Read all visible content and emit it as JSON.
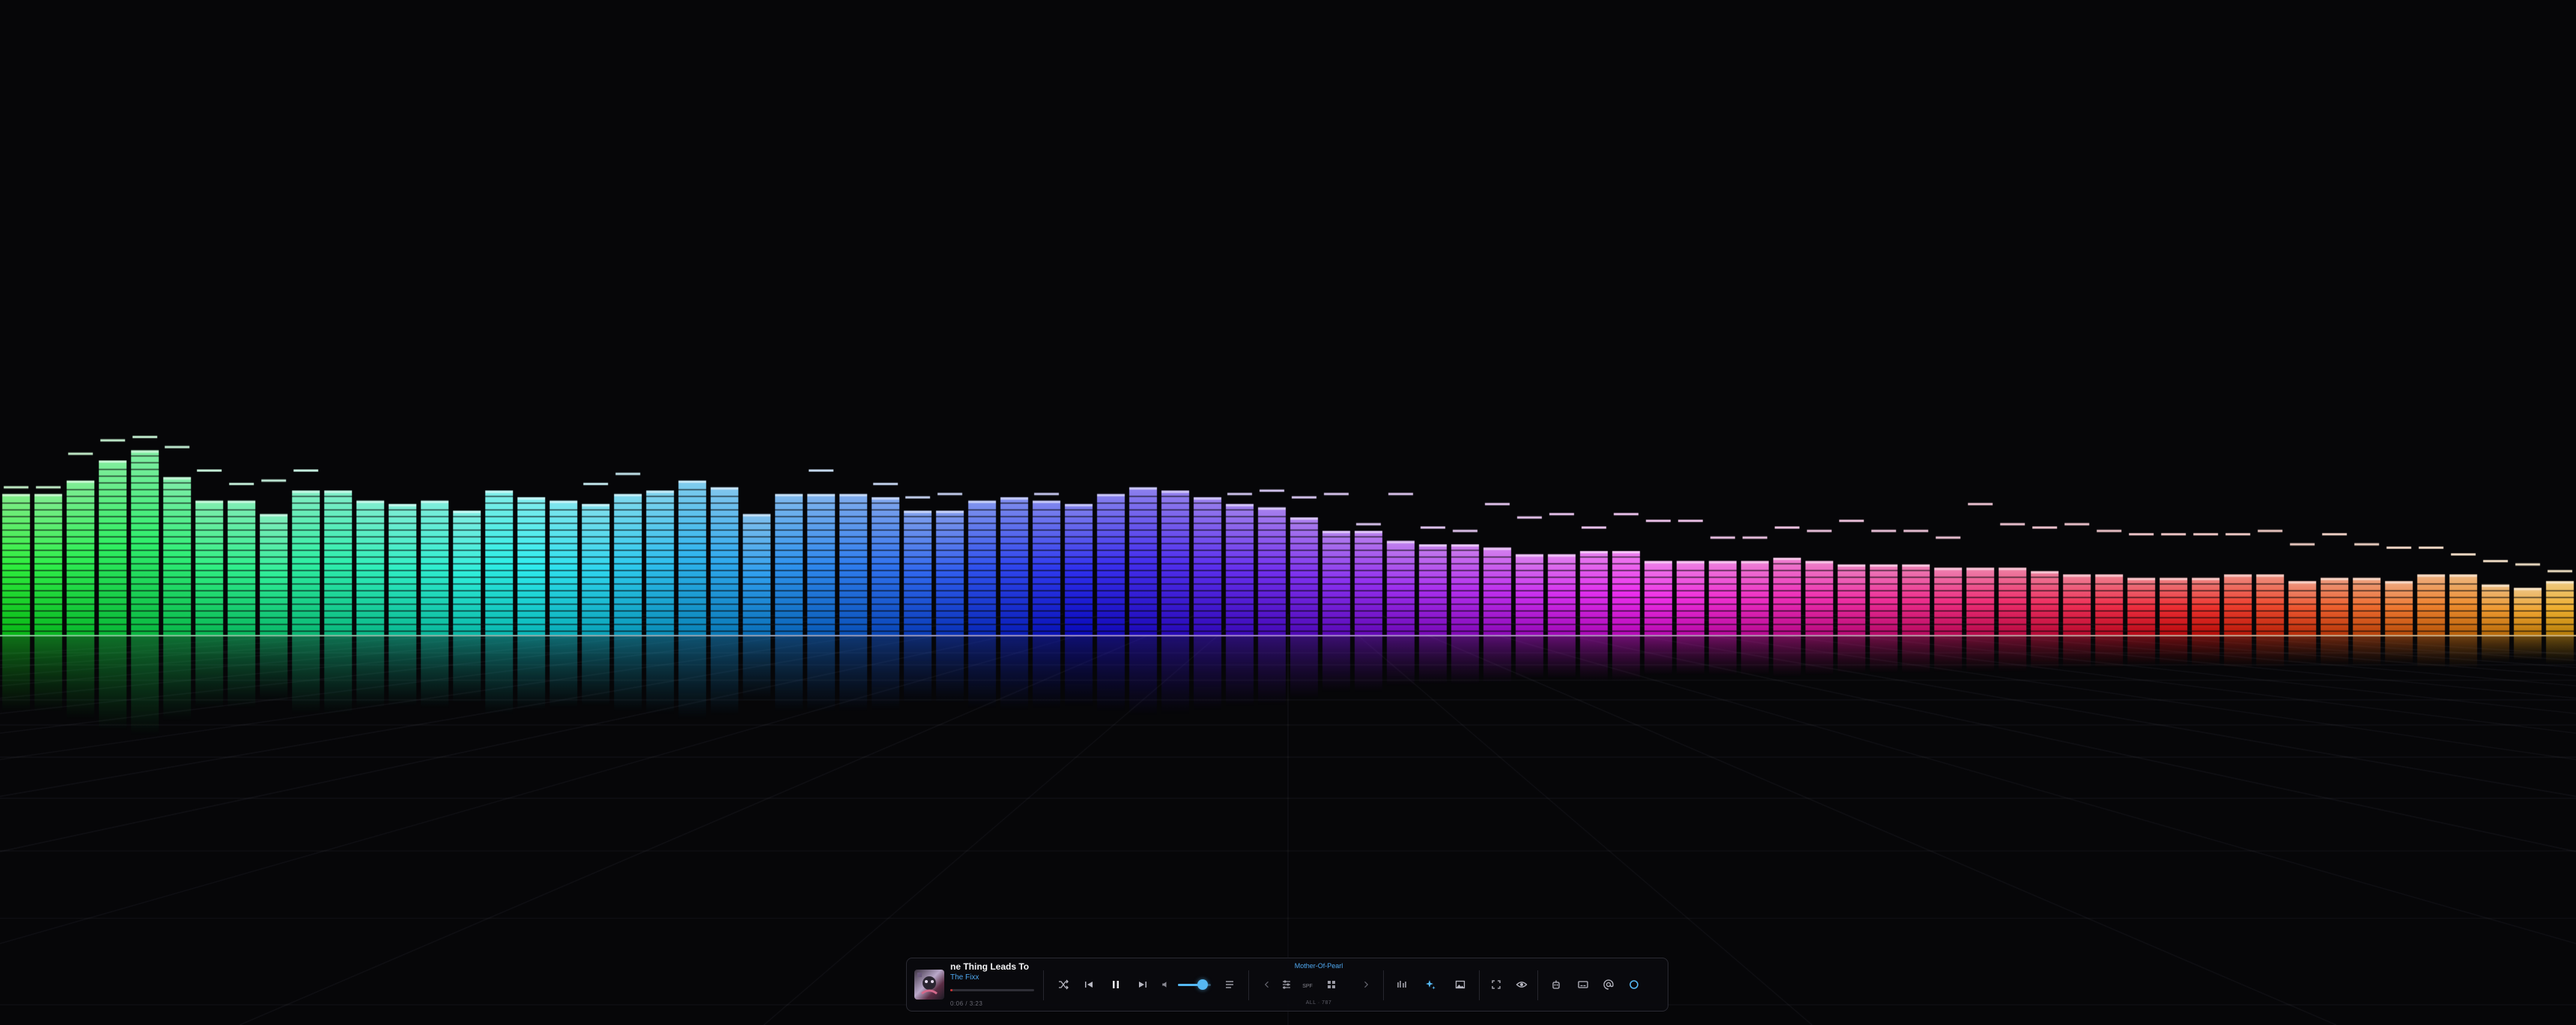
{
  "player": {
    "track_title": "ne Thing Leads To",
    "artist": "The Fixx",
    "time": "0:06 / 3:23",
    "progress": 0.03,
    "volume": 0.75,
    "preset_name": "Mother-Of-Pearl",
    "fps_badge": "SPF",
    "preset_meta": "ALL · 787"
  },
  "icons": {
    "album_art": "album-art",
    "shuffle": "shuffle-icon",
    "previous": "skip-previous-icon",
    "pause": "pause-icon",
    "next": "skip-next-icon",
    "volume": "volume-icon",
    "queue": "queue-list-icon",
    "prev_preset": "chevron-left-icon",
    "preset_settings": "sliders-icon",
    "grid": "grid-icon",
    "next_preset": "chevron-right-icon",
    "visualizer_mode": "bars-icon",
    "ai_sparkle": "sparkle-icon",
    "image": "image-icon",
    "fullscreen": "fullscreen-icon",
    "eye": "eye-icon",
    "robot": "robot-icon",
    "caption": "caption-icon",
    "at": "at-sign-icon",
    "circle": "circle-icon"
  },
  "colors": {
    "accent": "#4fa8f0",
    "background": "#060608",
    "progress": "#cc3333"
  },
  "visualizer": {
    "band_levels": [
      0.42,
      0.42,
      0.46,
      0.52,
      0.55,
      0.47,
      0.4,
      0.4,
      0.36,
      0.43,
      0.43,
      0.4,
      0.39,
      0.4,
      0.37,
      0.43,
      0.41,
      0.4,
      0.39,
      0.42,
      0.43,
      0.46,
      0.44,
      0.36,
      0.42,
      0.42,
      0.42,
      0.41,
      0.37,
      0.37,
      0.4,
      0.41,
      0.4,
      0.39,
      0.42,
      0.44,
      0.43,
      0.41,
      0.39,
      0.38,
      0.35,
      0.31,
      0.31,
      0.28,
      0.27,
      0.27,
      0.26,
      0.24,
      0.24,
      0.25,
      0.25,
      0.22,
      0.22,
      0.22,
      0.22,
      0.23,
      0.22,
      0.21,
      0.21,
      0.21,
      0.2,
      0.2,
      0.2,
      0.19,
      0.18,
      0.18,
      0.17,
      0.17,
      0.17,
      0.18,
      0.18,
      0.16,
      0.17,
      0.17,
      0.16,
      0.18,
      0.18,
      0.15,
      0.14,
      0.16
    ],
    "peak_levels": [
      0.43,
      0.43,
      0.53,
      0.57,
      0.58,
      0.55,
      0.48,
      0.44,
      0.45,
      0.48,
      0.43,
      0.4,
      0.39,
      0.4,
      0.37,
      0.43,
      0.41,
      0.4,
      0.44,
      0.47,
      0.43,
      0.46,
      0.44,
      0.36,
      0.42,
      0.48,
      0.42,
      0.44,
      0.4,
      0.41,
      0.4,
      0.41,
      0.41,
      0.39,
      0.42,
      0.44,
      0.43,
      0.41,
      0.41,
      0.42,
      0.4,
      0.41,
      0.32,
      0.41,
      0.31,
      0.3,
      0.38,
      0.34,
      0.35,
      0.31,
      0.35,
      0.33,
      0.33,
      0.28,
      0.28,
      0.31,
      0.3,
      0.33,
      0.3,
      0.3,
      0.28,
      0.38,
      0.32,
      0.31,
      0.32,
      0.3,
      0.29,
      0.29,
      0.29,
      0.29,
      0.3,
      0.26,
      0.29,
      0.26,
      0.25,
      0.25,
      0.23,
      0.21,
      0.2,
      0.18
    ]
  }
}
